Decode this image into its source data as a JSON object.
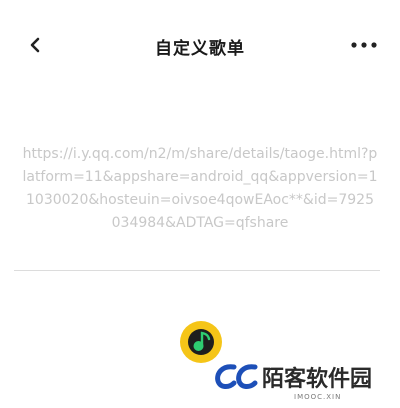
{
  "header": {
    "title": "自定义歌单",
    "back_icon": "chevron-left-icon",
    "more_icon": "more-horizontal-icon"
  },
  "content": {
    "share_url": "https://i.y.qq.com/n2/m/share/details/taoge.html?platform=11&appshare=android_qq&appversion=11030020&hosteuin=oivsoe4qowEAoc**&id=7925034984&ADTAG=qfshare"
  },
  "logo": {
    "icon": "qq-music-logo-icon",
    "colors": {
      "ring": "#f5c518",
      "center": "#1e1e1e",
      "note": "#2ecc71"
    }
  },
  "watermark": {
    "text": "陌客软件园",
    "subtext": "IMOOC.XIN",
    "icon": "mc-logo-icon",
    "color": "#1d4fb8"
  }
}
